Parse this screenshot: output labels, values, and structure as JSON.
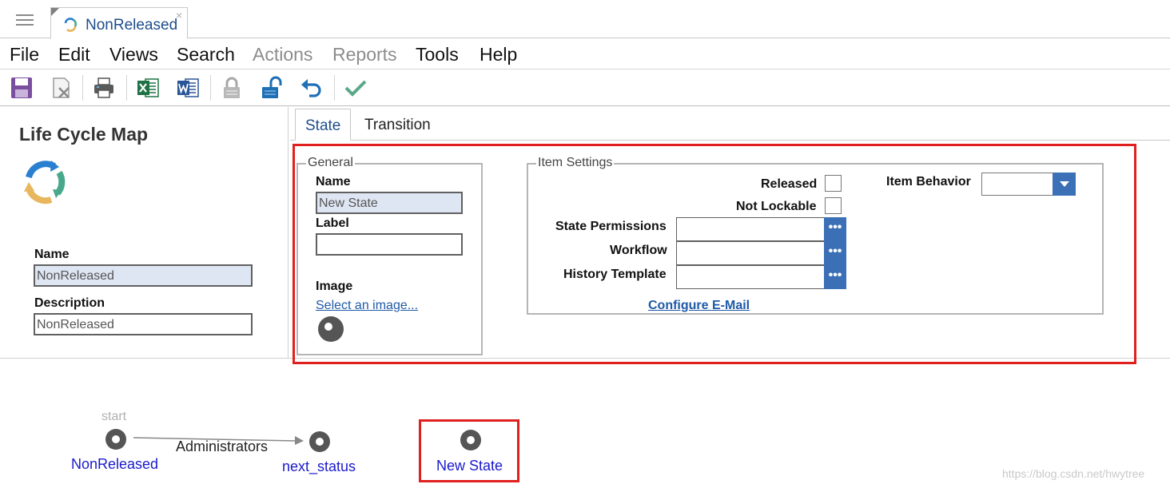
{
  "tab": {
    "title": "NonReleased",
    "close": "×"
  },
  "menu": [
    "File",
    "Edit",
    "Views",
    "Search",
    "Actions",
    "Reports",
    "Tools",
    "Help"
  ],
  "menu_disabled": [
    "Actions",
    "Reports"
  ],
  "toolbar_icons": [
    "save-icon",
    "discard-icon",
    "print-icon",
    "excel-icon",
    "word-icon",
    "unlock-icon",
    "lock-icon",
    "undo-icon",
    "done-icon"
  ],
  "left": {
    "title": "Life Cycle Map",
    "name_label": "Name",
    "name_value": "NonReleased",
    "description_label": "Description",
    "description_value": "NonReleased"
  },
  "pane_tabs": [
    "State",
    "Transition"
  ],
  "general": {
    "legend": "General",
    "name_label": "Name",
    "name_value": "New State",
    "label_label": "Label",
    "label_value": "",
    "image_label": "Image",
    "image_link": "Select an image..."
  },
  "item_settings": {
    "legend": "Item Settings",
    "released_label": "Released",
    "not_lockable_label": "Not Lockable",
    "item_behavior_label": "Item Behavior",
    "item_behavior_value": "",
    "state_permissions_label": "State Permissions",
    "workflow_label": "Workflow",
    "history_template_label": "History Template",
    "picker_glyph": "•••",
    "configure_link": "Configure E-Mail"
  },
  "map": {
    "start_label": "start",
    "nodes": [
      "NonReleased",
      "next_status",
      "New State"
    ],
    "transition_label": "Administrators"
  },
  "watermark": "https://blog.csdn.net/hwytree",
  "colors": {
    "accent": "#3b6fb6",
    "link": "#1f5aa6",
    "highlight": "#e0201e",
    "node": "#555555",
    "node_label": "#1a1acc"
  }
}
